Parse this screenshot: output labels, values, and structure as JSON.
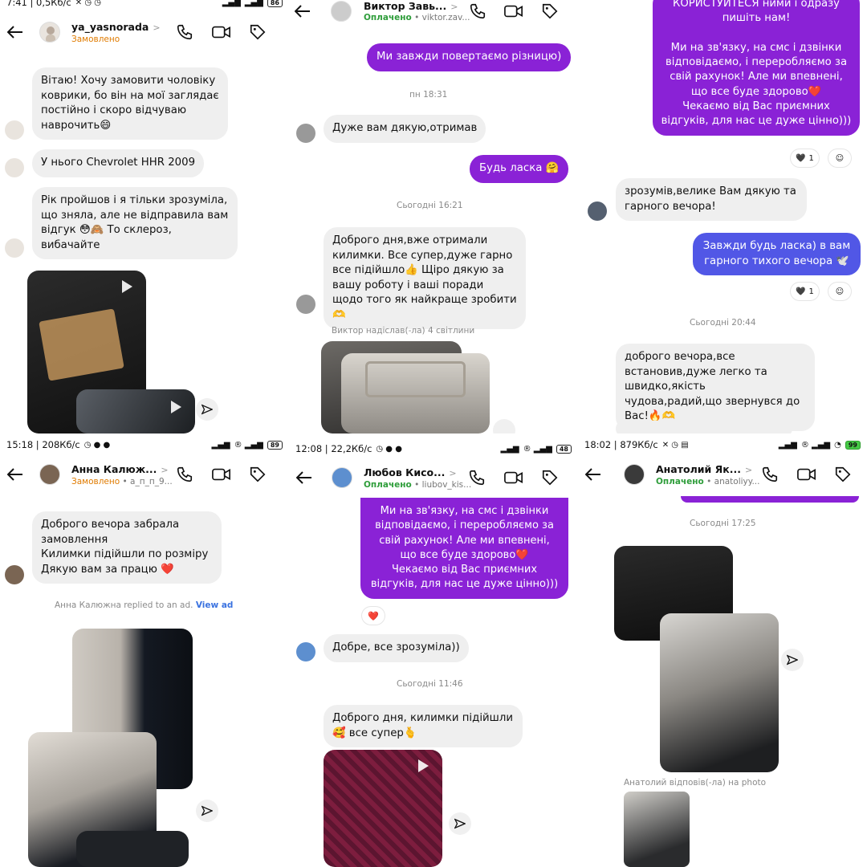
{
  "colors": {
    "purple_bubble": "#8a22d6",
    "blue_bubble": "#5157e6",
    "status_orange": "#e07b00",
    "status_green": "#2e9d3a",
    "link_blue": "#3a72e0"
  },
  "panels": [
    {
      "status_time": "7:41 | 0,5Кб/с",
      "status_battery": "86",
      "contact_name": "ya_yasnorada",
      "contact_status": "Замовлено",
      "messages": [
        "Вітаю! Хочу замовити чоловіку коврики, бо він на мої заглядає постійно і скоро відчуваю наврочить😄",
        "У нього Chevrolet HHR 2009",
        "Рік пройшов і я тільки зрозуміла, що зняла, але не відправила вам відгук 😳🙈 То склероз, вибачайте"
      ]
    },
    {
      "contact_name": "Виктор Завь...",
      "contact_status": "Оплачено",
      "contact_handle": "viktor.zav...",
      "messages": {
        "out_1": "Ми завжди повертаємо різницю)",
        "time_1": "пн 18:31",
        "in_1": "Дуже вам дякую,отримав",
        "out_2": "Будь ласка 🤗",
        "time_2": "Сьогодні 16:21",
        "in_2": "Доброго дня,вже отримали килимки. Все супер,дуже гарно все підійшло👍 Щіро дякую за вашу роботу і ваші поради щодо того як найкраще зробити🫶",
        "sys_1": "Виктор надіслав(-ла) 4 світлини"
      }
    },
    {
      "messages": {
        "out_1": "КОРИСТУЙТЕСЯ ними і одразу пишіть нам!\n\nМи на зв'язку, на смс і дзвінки відповідаємо, і переробляємо за свій рахунок! Але ми впевнені, що все буде здорово❤️\nЧекаємо від Вас приємних відгуків, для нас це дуже цінно)))",
        "react_1": "1",
        "in_1": "зрозумів,велике Вам дякую та гарного вечора!",
        "out_2": "Завжди будь ласка) в вам гарного тихого вечора 🕊️",
        "react_2": "1",
        "time_1": "Сьогодні 20:44",
        "in_2": "доброго вечора,все встановив,дуже легко та швидко,якість чудова,радий,що звернувся до Вас!🔥🫶"
      }
    },
    {
      "status_time": "15:18 | 208Кб/с",
      "status_battery": "89",
      "contact_name": "Анна Калюж...",
      "contact_status": "Замовлено",
      "contact_handle": "а_п_п_9...",
      "messages": {
        "in_1": "Доброго вечора забрала замовлення\nКилимки підійшли по розміру\nДякую вам за працю ❤️",
        "sys_1": "Анна Калюжна replied to an ad.",
        "sys_link": "View ad"
      }
    },
    {
      "status_time": "12:08 | 22,2Кб/с",
      "status_battery": "48",
      "contact_name": "Любов Кисо...",
      "contact_status": "Оплачено",
      "contact_handle": "liubov_kis...",
      "messages": {
        "out_1": "Ми на зв'язку, на смс і дзвінки відповідаємо, і переробляємо за свій рахунок! Але ми впевнені, що все буде здорово❤️\nЧекаємо від Вас приємних відгуків, для нас це дуже цінно)))",
        "react_1": "❤️",
        "in_1": "Добре, все зрозуміла))",
        "time_1": "Сьогодні 11:46",
        "in_2": "Доброго дня, килимки підійшли 🥰 все супер🫰"
      }
    },
    {
      "status_time": "18:02 | 879Кб/с",
      "status_battery": "99",
      "contact_name": "Анатолий Як...",
      "contact_status": "Оплачено",
      "contact_handle": "anatoliyy...",
      "messages": {
        "time_1": "Сьогодні 17:25",
        "sys_1": "Анатолий відповів(-ла) на photo"
      }
    }
  ]
}
